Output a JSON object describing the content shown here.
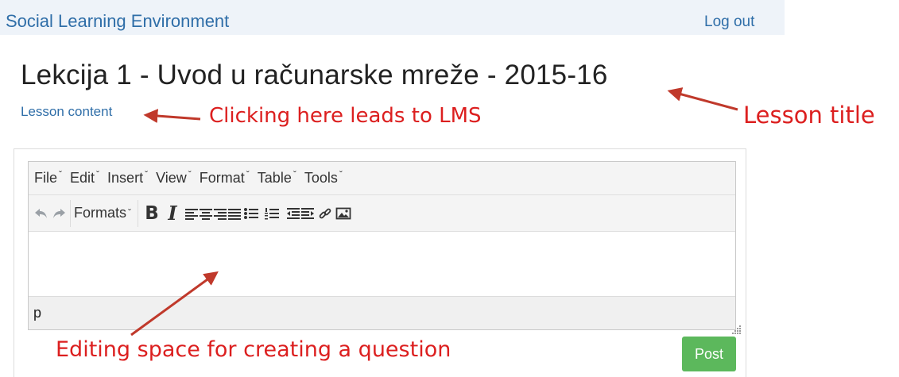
{
  "header": {
    "brand": "Social Learning Environment",
    "logout_label": "Log out"
  },
  "lesson": {
    "title": "Lekcija 1 - Uvod u računarske mreže - 2015-16",
    "content_link": "Lesson content"
  },
  "annotations": {
    "lms": "Clicking here leads to LMS",
    "title": "Lesson title",
    "editing": "Editing space for creating a question",
    "color": "#dc1f1f"
  },
  "editor": {
    "menu": [
      "File",
      "Edit",
      "Insert",
      "View",
      "Format",
      "Table",
      "Tools"
    ],
    "formats_label": "Formats",
    "bold_label": "B",
    "italic_label": "I",
    "status_path": "p",
    "toolbar_icons": [
      "undo-icon",
      "redo-icon",
      "bold-icon",
      "italic-icon",
      "align-left-icon",
      "align-center-icon",
      "align-right-icon",
      "align-justify-icon",
      "bullet-list-icon",
      "numbered-list-icon",
      "outdent-icon",
      "indent-icon",
      "link-icon",
      "image-icon"
    ]
  },
  "actions": {
    "post_label": "Post",
    "post_color": "#5cb85c"
  },
  "colors": {
    "link": "#2f6ea8",
    "topbar_bg": "#eef3f9"
  }
}
